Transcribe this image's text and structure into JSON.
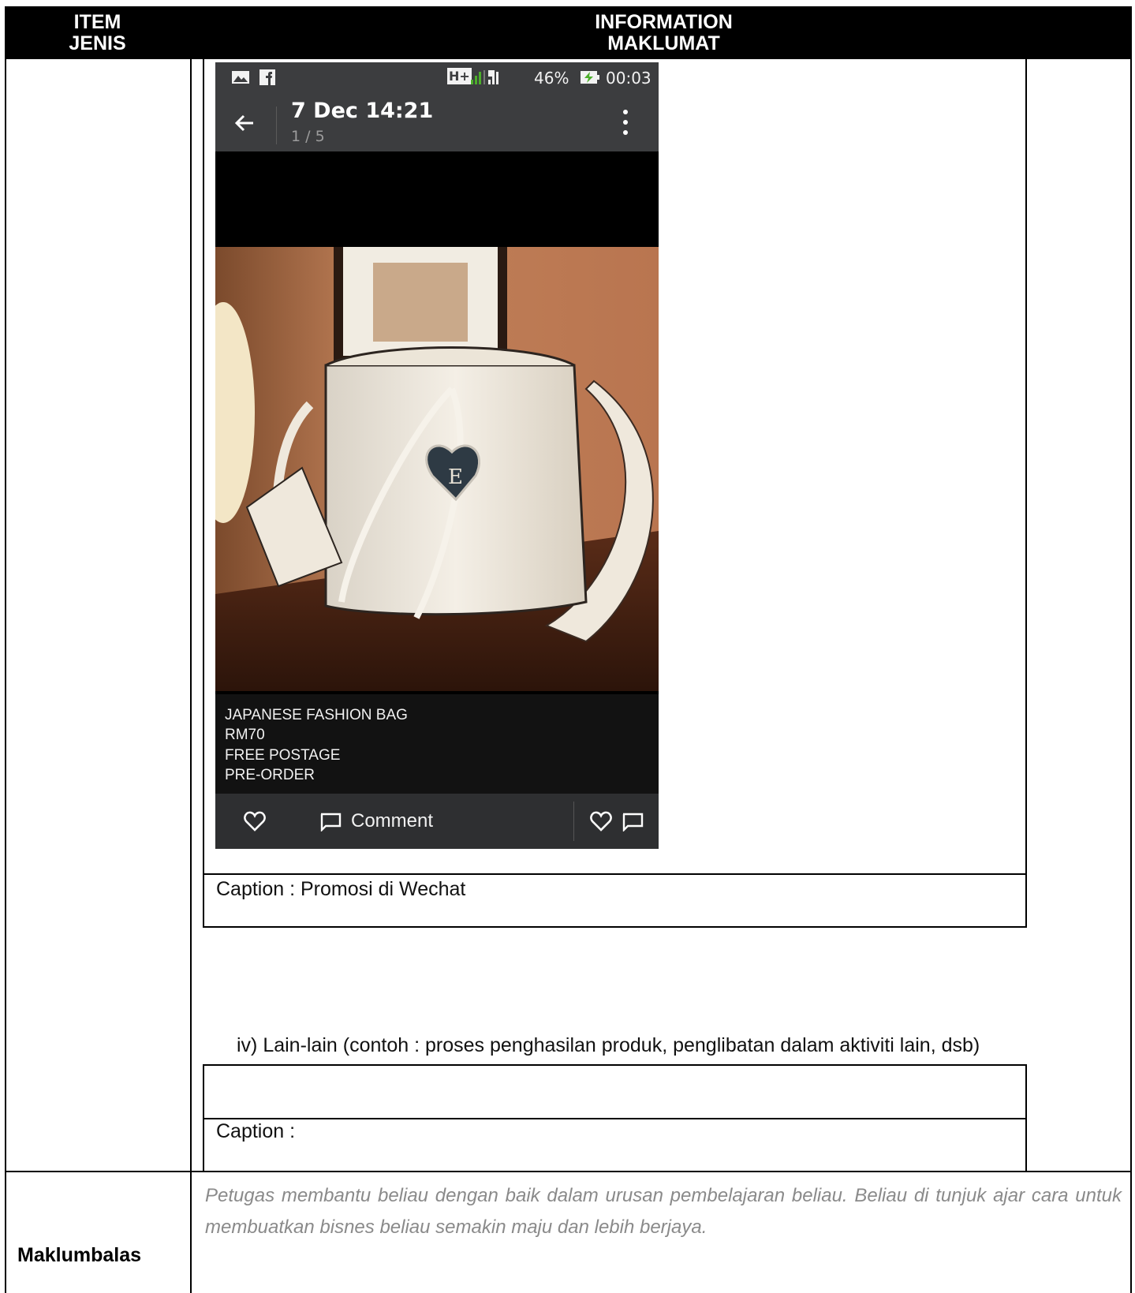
{
  "header": {
    "item_label_en": "ITEM",
    "item_label_ms": "JENIS",
    "info_label_en": "INFORMATION",
    "info_label_ms": "MAKLUMAT"
  },
  "phone": {
    "status": {
      "network": "H+",
      "battery": "46%",
      "time": "00:03"
    },
    "appbar": {
      "title": "7 Dec 14:21",
      "page_counter": "1 / 5"
    },
    "post_caption": [
      "JAPANESE FASHION BAG",
      "RM70",
      "FREE POSTAGE",
      "PRE-ORDER"
    ],
    "comment_label": "Comment",
    "photo_letter": "E"
  },
  "caption_1": "Caption : Promosi di Wechat",
  "section_iv": "iv)  Lain-lain (contoh : proses penghasilan produk, penglibatan dalam aktiviti lain, dsb)",
  "caption_2": "Caption :",
  "feedback": {
    "label": "Maklumbalas",
    "text": "Petugas membantu beliau dengan baik dalam urusan pembelajaran beliau. Beliau di tunjuk ajar cara untuk membuatkan bisnes beliau semakin maju dan lebih berjaya."
  },
  "colors": {
    "header_bg": "#000000",
    "phone_bar": "#3c3d3f",
    "signal_green": "#4caf2a",
    "feedback_text": "#8a8a8a"
  }
}
